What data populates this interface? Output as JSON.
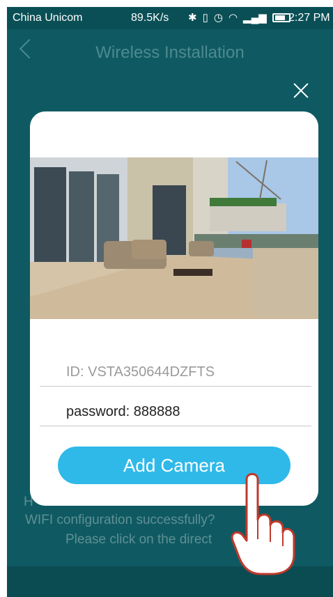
{
  "status_bar": {
    "carrier": "China Unicom",
    "speed": "89.5K/s",
    "time": "2:27 PM",
    "icons": [
      "bluetooth-icon",
      "vibrate-icon",
      "alarm-icon",
      "wifi-icon",
      "4g-signal-icon",
      "battery-icon"
    ]
  },
  "header": {
    "title": "Wireless Installation"
  },
  "background_text": {
    "line1": "H",
    "line2": "WIFI configuration successfully?",
    "line3": "Please click on the direct"
  },
  "dialog": {
    "id_text": "ID: VSTA350644DZFTS",
    "password_text": "password: 888888",
    "add_button": "Add Camera"
  },
  "colors": {
    "background": "#0f5a62",
    "button": "#2fb9e9"
  }
}
